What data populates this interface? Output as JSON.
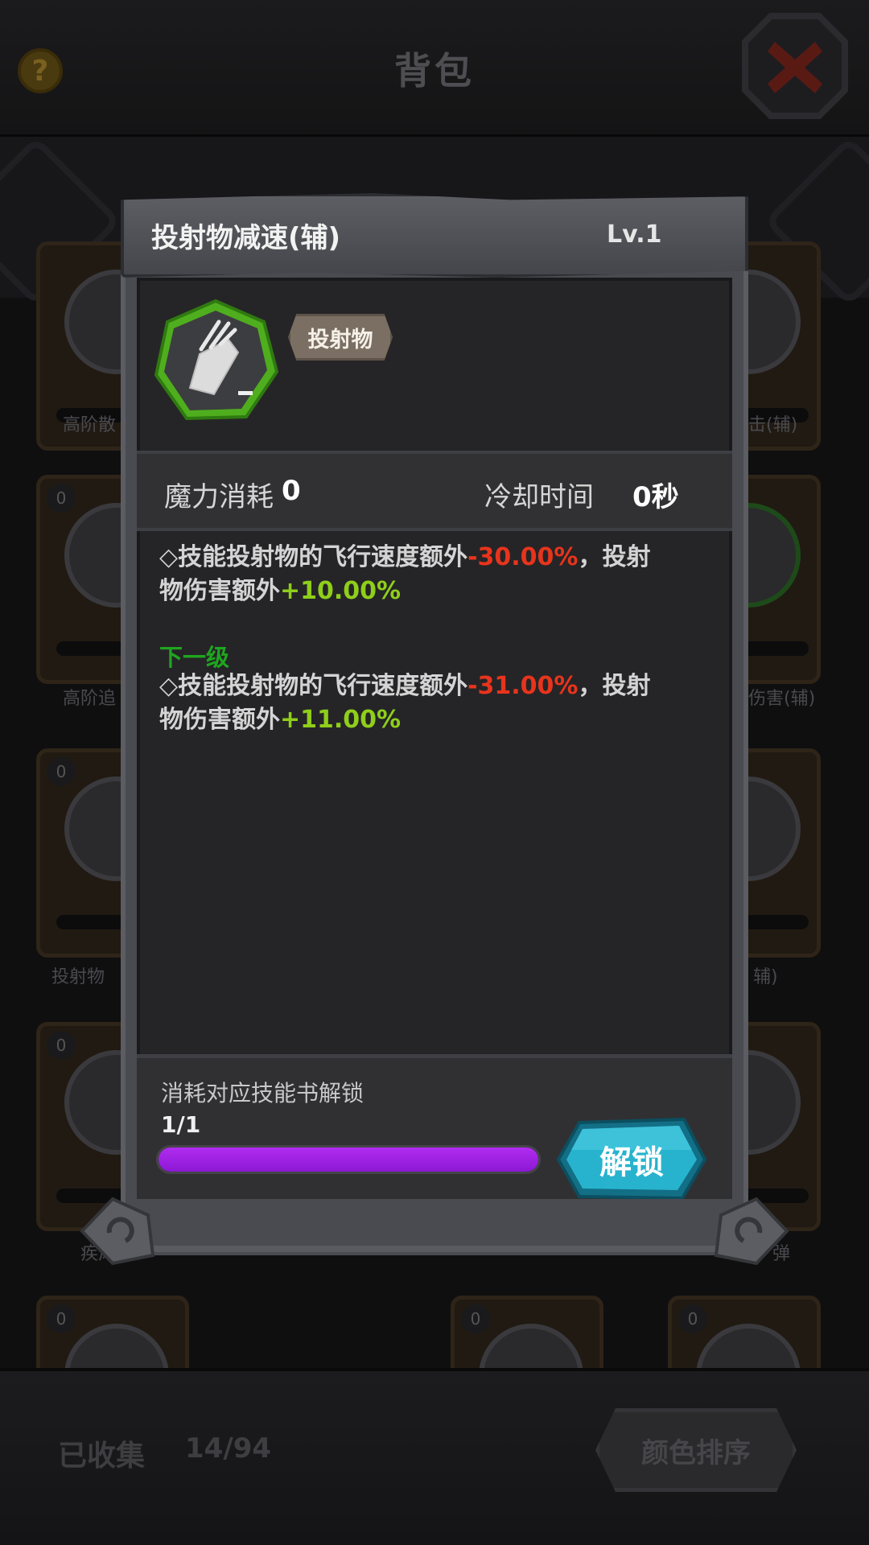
{
  "background": {
    "title": "背包",
    "help_glyph": "?",
    "counts": [
      "0",
      "0",
      "0",
      "0",
      "0",
      "0",
      "0",
      "0",
      "0"
    ],
    "labels": [
      "高阶散",
      "击(辅)",
      "高阶追",
      "伤害(辅)",
      "投射物",
      "辅)",
      "疾风",
      "弹"
    ],
    "collected_label": "已收集",
    "collected_value": "14/94",
    "sort_label": "颜色排序"
  },
  "dialog": {
    "title": "投射物减速(辅)",
    "level": "Lv.1",
    "icon": "projectile-slow-icon",
    "tag": "投射物",
    "stats": {
      "mana_label": "魔力消耗",
      "mana_value": "0",
      "cooldown_label": "冷却时间",
      "cooldown_value": "0秒"
    },
    "current": {
      "line1_prefix": "◇技能投射物的飞行速度额外",
      "line1_value": "-30.00%",
      "line1_suffix": "，投射",
      "line2_prefix": "物伤害额外",
      "line2_value": "+10.00%"
    },
    "next_label": "下一级",
    "next": {
      "line1_prefix": "◇技能投射物的飞行速度额外",
      "line1_value": "-31.00%",
      "line1_suffix": "，投射",
      "line2_prefix": "物伤害额外",
      "line2_value": "+11.00%"
    },
    "unlock": {
      "hint": "消耗对应技能书解锁",
      "progress_text": "1/1",
      "progress_fraction": 1.0,
      "button_label": "解锁"
    }
  },
  "colors": {
    "negative": "#e8341c",
    "positive": "#8fce1a",
    "next_level": "#1fa51f",
    "progress": "#a020f0",
    "unlock_button": "#1d9fb8"
  }
}
